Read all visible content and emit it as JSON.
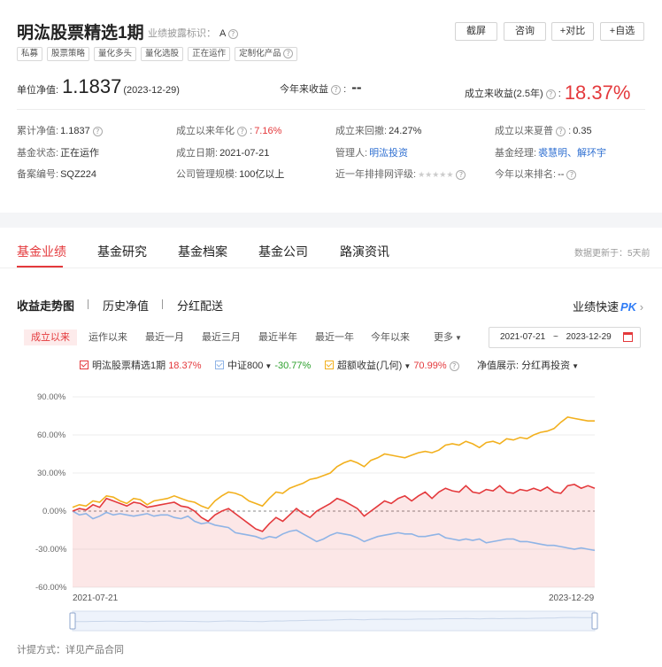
{
  "header": {
    "fund_name": "明汯股票精选1期",
    "disclosure_label": "业绩披露标识：",
    "disclosure_value": "A",
    "buttons": [
      "截屏",
      "咨询",
      "+对比",
      "+自选"
    ],
    "tags": [
      "私募",
      "股票策略",
      "量化多头",
      "量化选股",
      "正在运作",
      "定制化产品"
    ]
  },
  "summary": {
    "nav_label": "单位净值:",
    "nav_value": "1.1837",
    "nav_date": "(2023-12-29)",
    "ytd_label": "今年来收益",
    "ytd_value": "--",
    "since_label": "成立来收益(2.5年)",
    "since_value": "18.37%"
  },
  "details": [
    {
      "label": "累计净值:",
      "value": "1.1837"
    },
    {
      "label": "成立以来年化",
      "value": "7.16%"
    },
    {
      "label": "成立来回撤:",
      "value": "24.27%"
    },
    {
      "label": "成立以来夏普",
      "value": "0.35"
    },
    {
      "label": "基金状态:",
      "value": "正在运作"
    },
    {
      "label": "成立日期:",
      "value": "2021-07-21"
    },
    {
      "label": "管理人:",
      "value": "明汯投资"
    },
    {
      "label": "基金经理:",
      "value": "裘慧明、解环宇"
    },
    {
      "label": "备案编号:",
      "value": "SQZ224"
    },
    {
      "label": "公司管理规模:",
      "value": "100亿以上"
    },
    {
      "label": "近一年排排网评级:",
      "value": "★★★★★"
    },
    {
      "label": "今年以来排名:",
      "value": "--"
    }
  ],
  "main_tabs": [
    "基金业绩",
    "基金研究",
    "基金档案",
    "基金公司",
    "路演资讯"
  ],
  "update_note": "数据更新于：5天前",
  "sub_tabs": [
    "收益走势图",
    "历史净值",
    "分红配送"
  ],
  "quick_label": "业绩快速",
  "quick_pk": "PK",
  "ranges": [
    "成立以来",
    "运作以来",
    "最近一月",
    "最近三月",
    "最近半年",
    "最近一年",
    "今年以来",
    "更多"
  ],
  "date_range": {
    "start": "2021-07-21",
    "end": "2023-12-29",
    "sep": "~"
  },
  "legend": {
    "fund": {
      "name": "明汯股票精选1期",
      "value": "18.37%",
      "color": "#e4393c"
    },
    "index": {
      "name": "中证800",
      "value": "-30.77%",
      "color": "#8fb4e6"
    },
    "excess": {
      "name": "超额收益(几何)",
      "value": "70.99%",
      "color": "#f2b01e"
    },
    "nav_show_label": "净值展示:",
    "nav_show_value": "分红再投资"
  },
  "footnote": "计提方式：详见产品合同",
  "chart_data": {
    "type": "line",
    "x_start": "2021-07-21",
    "x_end": "2023-12-29",
    "y_ticks": [
      "90.00%",
      "60.00%",
      "30.00%",
      "0.00%",
      "-30.00%",
      "-60.00%"
    ],
    "ylim": [
      -60,
      90
    ],
    "series": [
      {
        "name": "明汯股票精选1期",
        "color": "#e4393c",
        "values": [
          0,
          2,
          1,
          5,
          3,
          10,
          8,
          6,
          4,
          7,
          6,
          3,
          4,
          5,
          6,
          7,
          4,
          3,
          0,
          -5,
          -8,
          -3,
          0,
          2,
          -2,
          -6,
          -10,
          -14,
          -16,
          -10,
          -5,
          -8,
          -3,
          2,
          -2,
          -5,
          0,
          3,
          6,
          10,
          8,
          5,
          2,
          -4,
          0,
          4,
          8,
          6,
          10,
          12,
          8,
          12,
          15,
          10,
          15,
          18,
          16,
          15,
          20,
          15,
          14,
          17,
          16,
          20,
          15,
          14,
          17,
          16,
          18,
          16,
          19,
          15,
          14,
          20,
          21,
          18,
          20,
          18
        ]
      },
      {
        "name": "中证800",
        "color": "#8fb4e6",
        "values": [
          0,
          -3,
          -2,
          -6,
          -4,
          -1,
          -3,
          -2,
          -3,
          -4,
          -3,
          -2,
          -4,
          -3,
          -3,
          -5,
          -6,
          -4,
          -8,
          -10,
          -9,
          -11,
          -12,
          -13,
          -17,
          -18,
          -19,
          -20,
          -22,
          -20,
          -21,
          -18,
          -16,
          -15,
          -18,
          -21,
          -24,
          -22,
          -19,
          -17,
          -18,
          -19,
          -21,
          -24,
          -22,
          -20,
          -19,
          -18,
          -17,
          -18,
          -18,
          -20,
          -20,
          -19,
          -18,
          -21,
          -22,
          -23,
          -22,
          -23,
          -22,
          -25,
          -24,
          -23,
          -22,
          -22,
          -24,
          -24,
          -25,
          -26,
          -27,
          -27,
          -28,
          -29,
          -30,
          -29,
          -30,
          -31
        ]
      },
      {
        "name": "超额收益(几何)",
        "color": "#f2b01e",
        "values": [
          3,
          5,
          4,
          8,
          7,
          12,
          11,
          8,
          6,
          10,
          9,
          5,
          8,
          9,
          10,
          12,
          10,
          8,
          7,
          4,
          2,
          8,
          12,
          15,
          14,
          12,
          8,
          6,
          4,
          10,
          15,
          14,
          18,
          20,
          22,
          25,
          26,
          28,
          30,
          35,
          38,
          40,
          38,
          35,
          40,
          42,
          45,
          44,
          43,
          42,
          44,
          46,
          47,
          46,
          48,
          52,
          53,
          52,
          55,
          53,
          50,
          54,
          55,
          53,
          57,
          56,
          58,
          57,
          60,
          62,
          63,
          65,
          70,
          74,
          73,
          72,
          71,
          71
        ]
      }
    ],
    "xlabel": "",
    "ylabel": ""
  }
}
